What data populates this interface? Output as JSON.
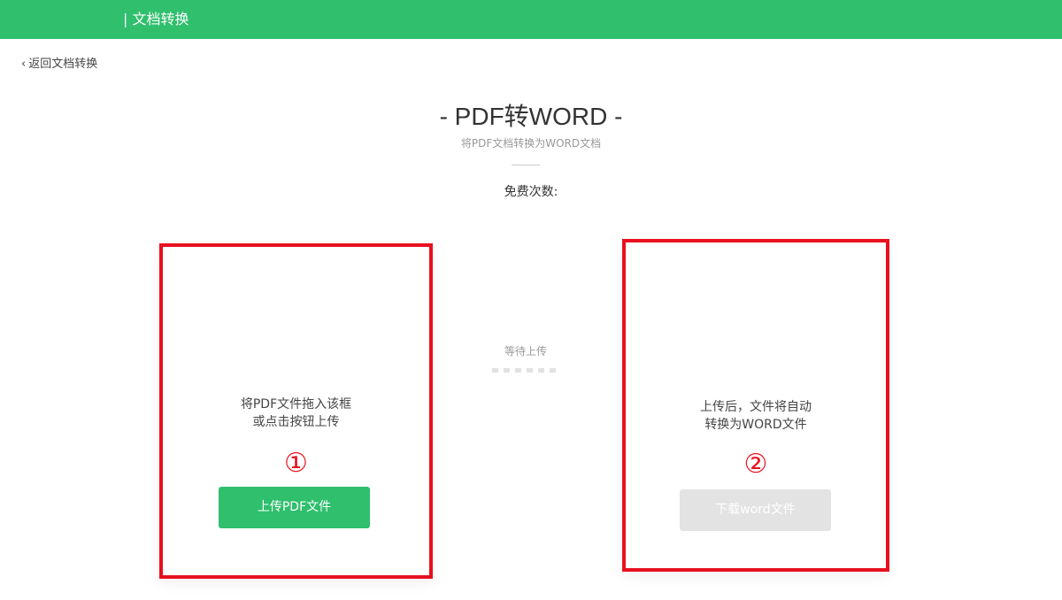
{
  "header": {
    "title": "| 文档转换"
  },
  "nav": {
    "back_icon": "chevron-left-icon",
    "back_label": "返回文档转换"
  },
  "page": {
    "title": "- PDF转WORD -",
    "subtitle": "将PDF文档转换为WORD文档",
    "free_count_label": "免费次数:"
  },
  "upload_card": {
    "line1": "将PDF文件拖入该框",
    "line2": "或点击按钮上传",
    "marker": "①",
    "button_label": "上传PDF文件"
  },
  "status": {
    "label": "等待上传"
  },
  "download_card": {
    "line1": "上传后，文件将自动",
    "line2": "转换为WORD文件",
    "marker": "②",
    "button_label": "下载word文件"
  },
  "colors": {
    "brand": "#2fbf6d",
    "highlight": "#e8101f",
    "disabled": "#e3e3e3"
  }
}
